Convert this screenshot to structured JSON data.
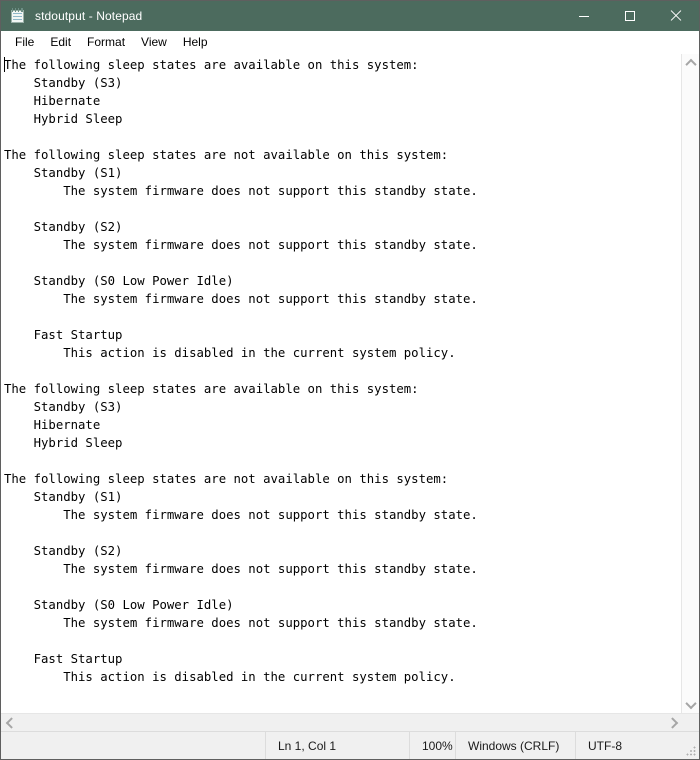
{
  "window": {
    "title": "stdoutput - Notepad",
    "icon": "notepad-icon",
    "title_bar_color": "#4c6b5e",
    "controls": {
      "minimize": "minimize-icon",
      "maximize": "maximize-icon",
      "close": "close-icon"
    }
  },
  "menubar": {
    "items": [
      {
        "label": "File"
      },
      {
        "label": "Edit"
      },
      {
        "label": "Format"
      },
      {
        "label": "View"
      },
      {
        "label": "Help"
      }
    ]
  },
  "editor": {
    "text": "The following sleep states are available on this system:\n    Standby (S3)\n    Hibernate\n    Hybrid Sleep\n\nThe following sleep states are not available on this system:\n    Standby (S1)\n        The system firmware does not support this standby state.\n\n    Standby (S2)\n        The system firmware does not support this standby state.\n\n    Standby (S0 Low Power Idle)\n        The system firmware does not support this standby state.\n\n    Fast Startup\n        This action is disabled in the current system policy.\n\nThe following sleep states are available on this system:\n    Standby (S3)\n    Hibernate\n    Hybrid Sleep\n\nThe following sleep states are not available on this system:\n    Standby (S1)\n        The system firmware does not support this standby state.\n\n    Standby (S2)\n        The system firmware does not support this standby state.\n\n    Standby (S0 Low Power Idle)\n        The system firmware does not support this standby state.\n\n    Fast Startup\n        This action is disabled in the current system policy."
  },
  "scrollbars": {
    "vertical": {
      "up": "chevron-up-icon",
      "down": "chevron-down-icon"
    },
    "horizontal": {
      "left": "chevron-left-icon",
      "right": "chevron-right-icon"
    }
  },
  "statusbar": {
    "position": "Ln 1, Col 1",
    "zoom": "100%",
    "line_endings": "Windows (CRLF)",
    "encoding": "UTF-8"
  }
}
